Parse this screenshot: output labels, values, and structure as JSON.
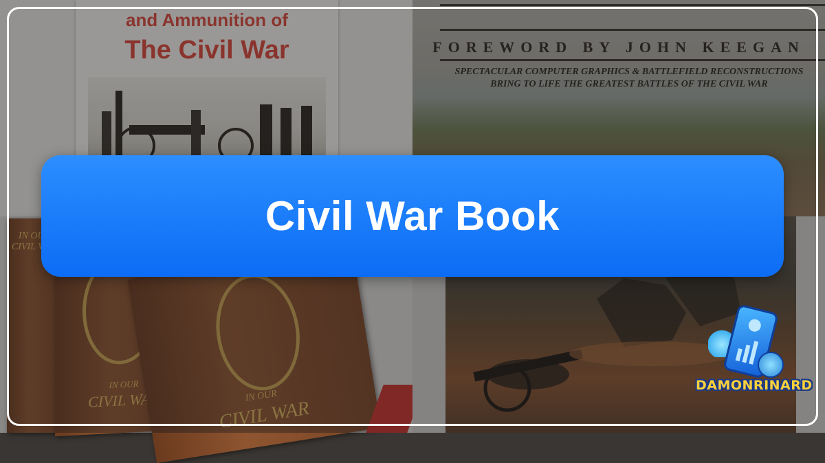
{
  "banner": {
    "title": "Civil War Book"
  },
  "background": {
    "top_left_cover": {
      "line1": "and Ammunition of",
      "line2": "The Civil War"
    },
    "top_right_cover": {
      "foreword": "FOREWORD BY JOHN KEEGAN",
      "tagline_line1": "SPECTACULAR COMPUTER GRAPHICS & BATTLEFIELD RECONSTRUCTIONS",
      "tagline_line2": "BRING TO LIFE THE GREATEST BATTLES OF THE CIVIL WAR"
    },
    "bottom_left_books": {
      "spine_text": "IN OUR CIVIL WAR",
      "front_text_1": "IN OUR",
      "front_text_2": "CIVIL WAR"
    }
  },
  "logo": {
    "wordmark": "DAMONRINARD"
  },
  "colors": {
    "banner_blue": "#1a7dff",
    "frame": "#ffffff",
    "cover_red": "#d9463a",
    "logo_yellow": "#ffd23a"
  }
}
